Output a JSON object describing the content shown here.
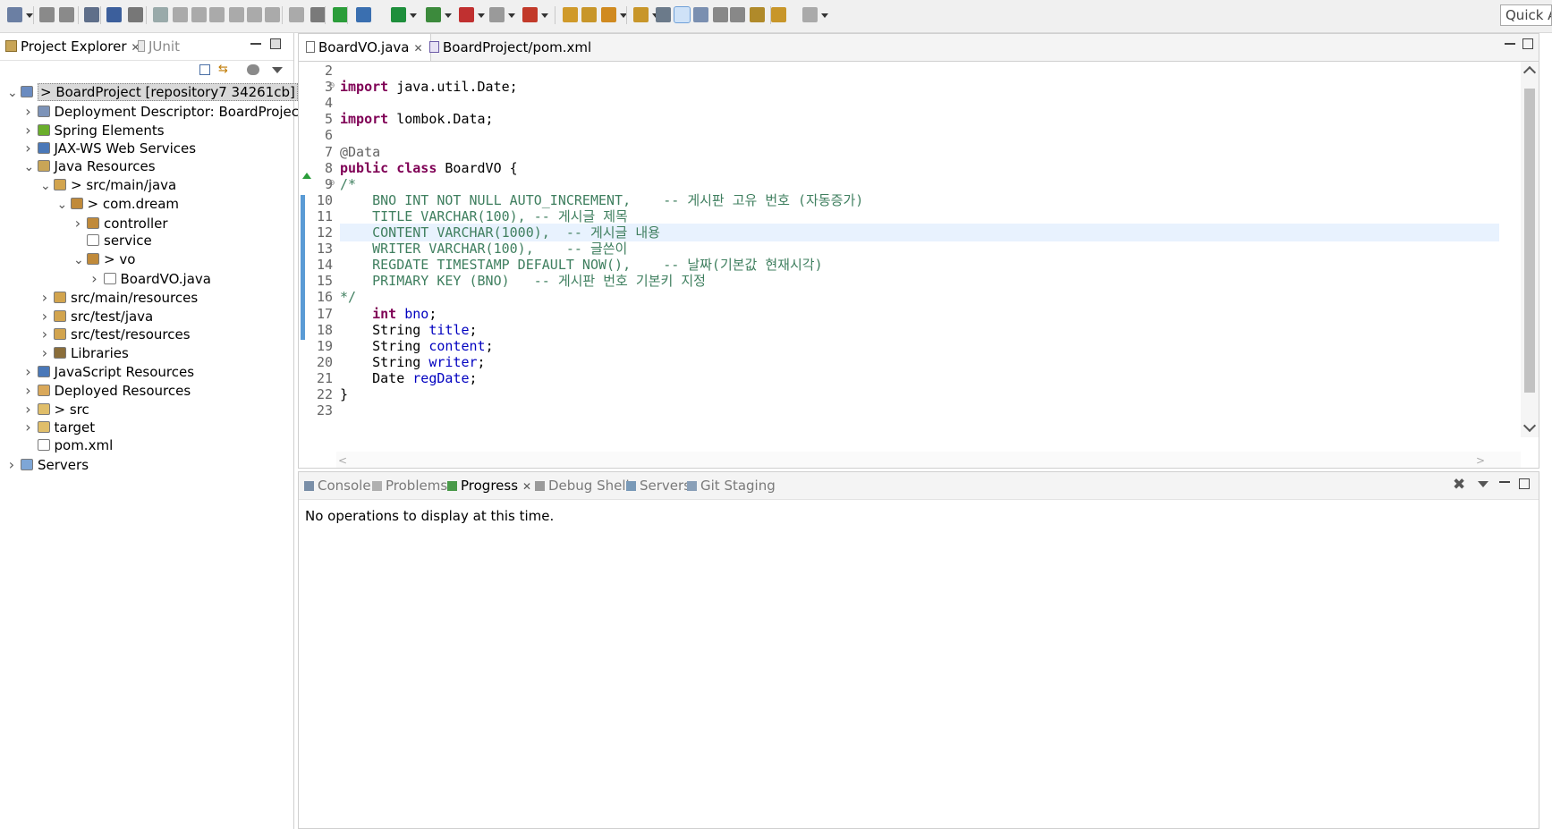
{
  "toolbar": {
    "quick_access_label": "Quick A",
    "icons": [
      "new-icon",
      "save-icon",
      "save-all-icon",
      "binary-icon",
      "console-icon",
      "skip-breakpoints-icon",
      "resume-icon",
      "suspend-icon",
      "terminate-icon",
      "disconnect-icon",
      "step-into-icon",
      "step-over-icon",
      "step-return-icon",
      "drop-to-frame-icon",
      "use-step-filters-icon",
      "refresh-icon",
      "debug-icon",
      "run-icon",
      "coverage-icon",
      "external-tools-icon",
      "stop-icon",
      "external-run-icon",
      "open-type-icon",
      "open-task-icon",
      "search-icon",
      "open-folder-icon",
      "toggle-mark-occurrences-icon",
      "toggle-highlight-icon",
      "toggle-block-selection-icon",
      "show-whitespace-icon",
      "pin-icon",
      "last-edit-icon",
      "back-icon",
      "forward-icon"
    ]
  },
  "explorer": {
    "tabs": [
      {
        "label": "Project Explorer",
        "active": true
      },
      {
        "label": "JUnit",
        "active": false
      }
    ],
    "tree": [
      {
        "label": "> BoardProject [repository7 34261cb]",
        "depth": 0,
        "expanded": true,
        "selected": true,
        "icon": "project-icon"
      },
      {
        "label": "Deployment Descriptor: BoardProject",
        "depth": 1,
        "expanded": false,
        "icon": "descriptor-icon"
      },
      {
        "label": "Spring Elements",
        "depth": 1,
        "expanded": false,
        "icon": "spring-icon"
      },
      {
        "label": "JAX-WS Web Services",
        "depth": 1,
        "expanded": false,
        "icon": "webservice-icon"
      },
      {
        "label": "Java Resources",
        "depth": 1,
        "expanded": true,
        "icon": "java-resources-icon"
      },
      {
        "label": "> src/main/java",
        "depth": 2,
        "expanded": true,
        "icon": "source-folder-icon"
      },
      {
        "label": "> com.dream",
        "depth": 3,
        "expanded": true,
        "icon": "package-icon"
      },
      {
        "label": "controller",
        "depth": 4,
        "expanded": false,
        "icon": "package-icon"
      },
      {
        "label": "service",
        "depth": 4,
        "expanded": null,
        "icon": "empty-package-icon"
      },
      {
        "label": "> vo",
        "depth": 4,
        "expanded": true,
        "icon": "package-icon"
      },
      {
        "label": "BoardVO.java",
        "depth": 5,
        "expanded": false,
        "icon": "java-file-icon"
      },
      {
        "label": "src/main/resources",
        "depth": 2,
        "expanded": false,
        "icon": "source-folder-icon"
      },
      {
        "label": "src/test/java",
        "depth": 2,
        "expanded": false,
        "icon": "source-folder-icon"
      },
      {
        "label": "src/test/resources",
        "depth": 2,
        "expanded": false,
        "icon": "source-folder-icon"
      },
      {
        "label": "Libraries",
        "depth": 2,
        "expanded": false,
        "icon": "libraries-icon"
      },
      {
        "label": "JavaScript Resources",
        "depth": 1,
        "expanded": false,
        "icon": "js-resources-icon"
      },
      {
        "label": "Deployed Resources",
        "depth": 1,
        "expanded": false,
        "icon": "deployed-icon"
      },
      {
        "label": "> src",
        "depth": 1,
        "expanded": false,
        "icon": "folder-icon"
      },
      {
        "label": "target",
        "depth": 1,
        "expanded": false,
        "icon": "folder-icon"
      },
      {
        "label": "pom.xml",
        "depth": 1,
        "expanded": null,
        "icon": "xml-file-icon"
      },
      {
        "label": "Servers",
        "depth": 0,
        "expanded": false,
        "icon": "servers-icon"
      }
    ]
  },
  "editor": {
    "tabs": [
      {
        "label": "BoardVO.java",
        "active": true
      },
      {
        "label": "BoardProject/pom.xml",
        "active": false
      }
    ],
    "lines": [
      {
        "n": "2",
        "tokens": []
      },
      {
        "n": "3",
        "tokens": [
          {
            "t": "import",
            "c": "kw"
          },
          {
            "t": " java.util.Date;",
            "c": ""
          }
        ]
      },
      {
        "n": "4",
        "tokens": []
      },
      {
        "n": "5",
        "tokens": [
          {
            "t": "import",
            "c": "kw"
          },
          {
            "t": " lombok.Data;",
            "c": ""
          }
        ]
      },
      {
        "n": "6",
        "tokens": []
      },
      {
        "n": "7",
        "tokens": [
          {
            "t": "@Data",
            "c": "ann"
          }
        ]
      },
      {
        "n": "8",
        "tokens": [
          {
            "t": "public",
            "c": "kw"
          },
          {
            "t": " ",
            "c": ""
          },
          {
            "t": "class",
            "c": "kw"
          },
          {
            "t": " BoardVO {",
            "c": ""
          }
        ]
      },
      {
        "n": "9",
        "tokens": [
          {
            "t": "/*",
            "c": "cmt"
          }
        ]
      },
      {
        "n": "10",
        "tokens": [
          {
            "t": "    BNO INT NOT NULL AUTO_INCREMENT,    -- 게시판 고유 번호 (자동증가)",
            "c": "cmt"
          }
        ]
      },
      {
        "n": "11",
        "tokens": [
          {
            "t": "    TITLE VARCHAR(100), -- 게시글 제목",
            "c": "cmt"
          }
        ]
      },
      {
        "n": "12",
        "tokens": [
          {
            "t": "    CONTENT VARCHAR(1000),  -- 게시글 내용",
            "c": "cmt"
          }
        ]
      },
      {
        "n": "13",
        "tokens": [
          {
            "t": "    WRITER VARCHAR(100),    -- 글쓴이",
            "c": "cmt"
          }
        ]
      },
      {
        "n": "14",
        "tokens": [
          {
            "t": "    REGDATE TIMESTAMP DEFAULT NOW(),    -- 날짜(기본값 현재시각)",
            "c": "cmt"
          }
        ]
      },
      {
        "n": "15",
        "tokens": [
          {
            "t": "    PRIMARY KEY (BNO)   -- 게시판 번호 기본키 지정",
            "c": "cmt"
          }
        ]
      },
      {
        "n": "16",
        "tokens": [
          {
            "t": "*/",
            "c": "cmt"
          }
        ]
      },
      {
        "n": "17",
        "tokens": [
          {
            "t": "    ",
            "c": ""
          },
          {
            "t": "int",
            "c": "kw"
          },
          {
            "t": " ",
            "c": ""
          },
          {
            "t": "bno",
            "c": "fld"
          },
          {
            "t": ";",
            "c": ""
          }
        ]
      },
      {
        "n": "18",
        "tokens": [
          {
            "t": "    String ",
            "c": ""
          },
          {
            "t": "title",
            "c": "fld"
          },
          {
            "t": ";",
            "c": ""
          }
        ]
      },
      {
        "n": "19",
        "tokens": [
          {
            "t": "    String ",
            "c": ""
          },
          {
            "t": "content",
            "c": "fld"
          },
          {
            "t": ";",
            "c": ""
          }
        ]
      },
      {
        "n": "20",
        "tokens": [
          {
            "t": "    String ",
            "c": ""
          },
          {
            "t": "writer",
            "c": "fld"
          },
          {
            "t": ";",
            "c": ""
          }
        ]
      },
      {
        "n": "21",
        "tokens": [
          {
            "t": "    Date ",
            "c": ""
          },
          {
            "t": "regDate",
            "c": "fld"
          },
          {
            "t": ";",
            "c": ""
          }
        ]
      },
      {
        "n": "22",
        "tokens": [
          {
            "t": "}",
            "c": ""
          }
        ]
      },
      {
        "n": "23",
        "tokens": []
      }
    ],
    "current_line": "12"
  },
  "bottom": {
    "tabs": [
      {
        "label": "Console",
        "active": false,
        "icon": "console-icon"
      },
      {
        "label": "Problems",
        "active": false,
        "icon": "problems-icon"
      },
      {
        "label": "Progress",
        "active": true,
        "icon": "progress-icon"
      },
      {
        "label": "Debug Shell",
        "active": false,
        "icon": "debug-shell-icon"
      },
      {
        "label": "Servers",
        "active": false,
        "icon": "servers-icon"
      },
      {
        "label": "Git Staging",
        "active": false,
        "icon": "git-staging-icon"
      }
    ],
    "message": "No operations to display at this time."
  },
  "colors": {
    "keyword": "#7f0055",
    "comment": "#3f7f5f",
    "field": "#0000c0",
    "annotation": "#646464",
    "current_line": "#e8f2fe"
  }
}
